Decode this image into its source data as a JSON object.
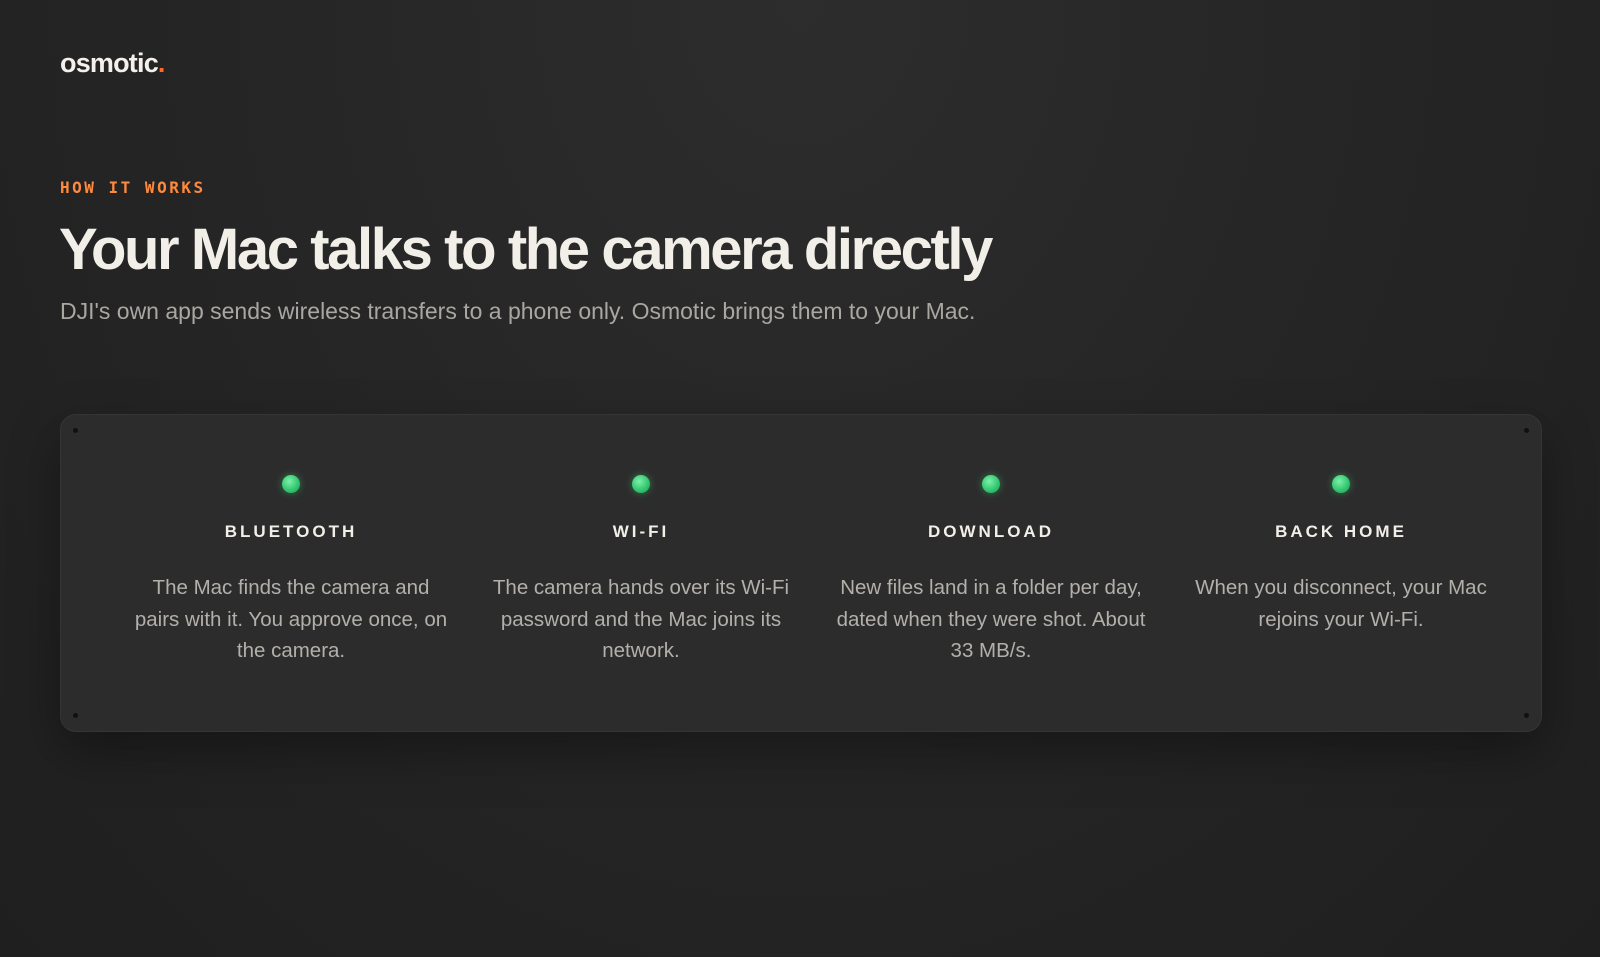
{
  "brand": {
    "name": "osmotic",
    "dot": ".",
    "dot_color": "#ff6a2b"
  },
  "hero": {
    "eyebrow": "HOW IT WORKS",
    "title": "Your Mac talks to the camera directly",
    "subtitle": "DJI's own app sends wireless transfers to a phone only. Osmotic brings them to your Mac."
  },
  "colors": {
    "accent": "#ff8a3d",
    "status_led": "#34c872",
    "background": "#262626",
    "panel": "#2c2c2c"
  },
  "steps": [
    {
      "icon": "status-led-icon",
      "title": "BLUETOOTH",
      "description": "The Mac finds the camera and pairs with it. You approve once, on the camera."
    },
    {
      "icon": "status-led-icon",
      "title": "WI-FI",
      "description": "The camera hands over its Wi-Fi password and the Mac joins its network."
    },
    {
      "icon": "status-led-icon",
      "title": "DOWNLOAD",
      "description": "New files land in a folder per day, dated when they were shot. About 33 MB/s."
    },
    {
      "icon": "status-led-icon",
      "title": "BACK HOME",
      "description": "When you disconnect, your Mac rejoins your Wi-Fi."
    }
  ]
}
